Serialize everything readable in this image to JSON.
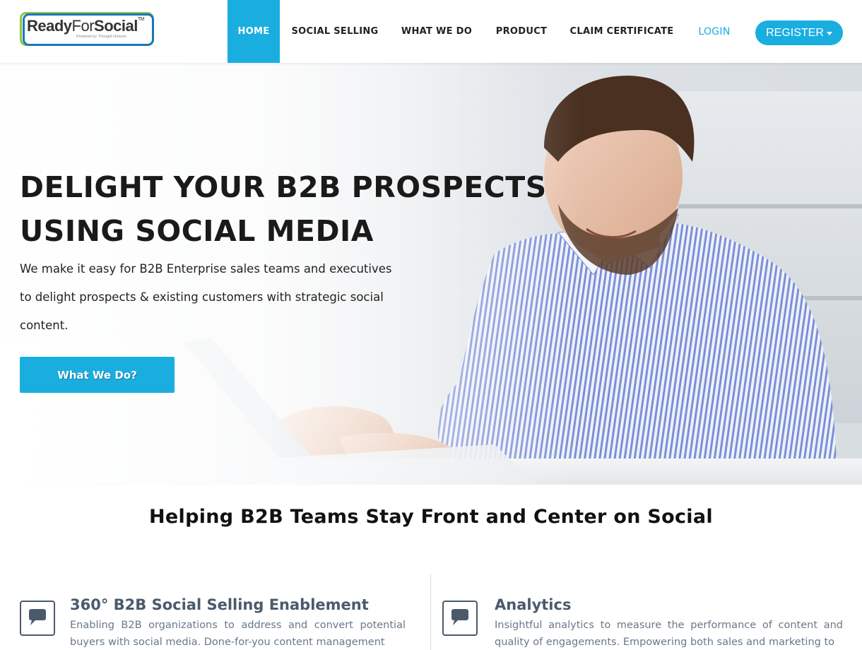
{
  "brand": {
    "name_part1": "Ready",
    "name_part2": "For",
    "name_part3": "Social",
    "tm": "TM",
    "tagline": "Powered by Thought Horizon"
  },
  "nav": {
    "home": "HOME",
    "social_selling": "SOCIAL SELLING",
    "what_we_do": "WHAT WE DO",
    "product": "PRODUCT",
    "claim_certificate": "CLAIM CERTIFICATE",
    "login": "LOGIN",
    "register": "REGISTER"
  },
  "hero": {
    "title": "DELIGHT YOUR B2B PROSPECTS USING SOCIAL MEDIA",
    "text": "We make it easy for B2B Enterprise sales teams and executives to delight prospects & existing customers with strategic social content.",
    "button": "What We Do?"
  },
  "section": {
    "title": "Helping B2B Teams Stay Front and Center on Social"
  },
  "features": [
    {
      "icon": "chat-bubble-icon",
      "title": "360° B2B Social Selling Enablement",
      "description": "Enabling B2B organizations to address and convert potential buyers with social media. Done-for-you content management"
    },
    {
      "icon": "chat-bubble-icon",
      "title": "Analytics",
      "description": "Insightful analytics to measure the performance of content and quality of engagements. Empowering both sales and marketing to"
    }
  ],
  "colors": {
    "accent": "#1aaee0",
    "logo_green": "#8cc63f",
    "logo_blue": "#1c75bc",
    "feature_title": "#4b5a6b"
  }
}
